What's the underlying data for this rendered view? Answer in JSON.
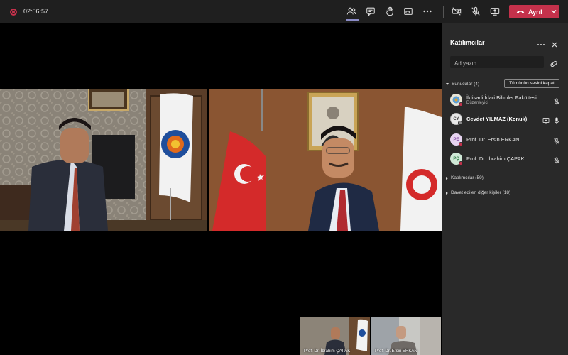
{
  "topbar": {
    "timer": "02:06:57",
    "leave_label": "Ayrıl",
    "icons": [
      "record-icon",
      "participants-icon",
      "chat-icon",
      "raise-hand-icon",
      "view-icon",
      "more-icon",
      "camera-off-icon",
      "mic-off-icon",
      "share-screen-icon",
      "phone-icon",
      "chevron-down-icon"
    ]
  },
  "panel": {
    "title": "Katılımcılar",
    "search_placeholder": "Ad yazın",
    "presenters_header": "Sunucular (4)",
    "mute_all_label": "Tümünün sesini kapat",
    "presenters": [
      {
        "initials": "",
        "name": "İktisadi İdari Bilimler Fakültesi",
        "role": "Düzenleyici",
        "avatar_color": "#5aa0d8",
        "status": "red",
        "right_icons": [
          "mic-off-icon"
        ]
      },
      {
        "initials": "CY",
        "name": "Cevdet YILMAZ (Konuk)",
        "role": "",
        "avatar_color": "#e8e8e8",
        "status": "away",
        "right_icons": [
          "screen-share-icon",
          "mic-icon"
        ]
      },
      {
        "initials": "PE",
        "name": "Prof. Dr. Ersin ERKAN",
        "role": "",
        "avatar_color": "#e6d3f0",
        "status": "red",
        "right_icons": [
          "mic-off-icon"
        ]
      },
      {
        "initials": "PÇ",
        "name": "Prof. Dr. İbrahim ÇAPAK",
        "role": "",
        "avatar_color": "#cfe8d6",
        "status": "red",
        "right_icons": [
          "mic-off-icon"
        ]
      }
    ],
    "attendees_header": "Katılımcılar (59)",
    "invited_header": "Davet edilen diğer kişiler (18)"
  },
  "thumbnails": [
    {
      "label": "Prof. Dr. İbrahim ÇAPAK"
    },
    {
      "label": "Prof. Dr. Ersin ERKAN"
    }
  ],
  "colors": {
    "accent": "#8b8cc7",
    "leave": "#c4314b",
    "panel_bg": "#292929",
    "topbar_bg": "#1f1f1f"
  }
}
